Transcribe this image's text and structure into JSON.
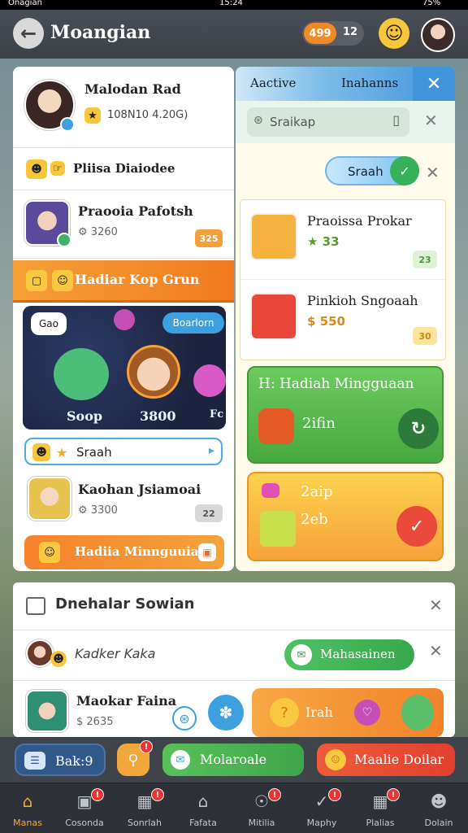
{
  "status_bar": {
    "carrier": "Onagian",
    "time": "15:24",
    "battery": "75%"
  },
  "header": {
    "title": "Moangian",
    "coin_value": "499",
    "count": "12"
  },
  "left_panel": {
    "profile": {
      "name": "Malodan Rad",
      "stats": "108N10 4.20G)"
    },
    "section_label": "Pliisa Diaiodee",
    "friend": {
      "name": "Praooia Pafotsh",
      "score": "3260",
      "badge": "325"
    },
    "banner_label": "Hadiar Kop Grun",
    "scene": {
      "bubble": "Gao",
      "pill": "Boarlorn",
      "label_left": "Soop",
      "label_right": "3800",
      "label_edge": "Fc"
    },
    "search_label": "Sraah",
    "friend2": {
      "name": "Kaohan Jsiamoai",
      "score": "3300",
      "badge": "22"
    },
    "button_label": "Hadiia Minnguuian"
  },
  "right_panel": {
    "tabs": [
      "Aactive",
      "Inahanns"
    ],
    "search_placeholder": "Sraikap",
    "search_pill": "Sraah",
    "items": [
      {
        "name": "Praoissa Prokar",
        "score": "33",
        "badge": "23"
      },
      {
        "name": "Pinkioh Sngoaah",
        "score": "550",
        "badge": "30"
      }
    ],
    "green_card": {
      "title": "H: Hadiah Mingguaan",
      "sub": "2ifin"
    },
    "yellow_card": {
      "line1": "2aip",
      "line2": "2eb"
    }
  },
  "bottom_panel": {
    "title": "Dnehalar Sowian",
    "row_name": "Kadker Kaka",
    "row_button": "Mahasainen",
    "row2_name": "Maokar Faina",
    "row2_score": "2635",
    "strip_label": "Irah"
  },
  "action_bar": {
    "left_btn": "Bak:9",
    "green_btn": "Molaroale",
    "red_btn": "Maalie Doilar"
  },
  "nav": [
    {
      "label": "Manas",
      "icon": "home-icon"
    },
    {
      "label": "Cosonda",
      "icon": "gamepad-icon"
    },
    {
      "label": "Sonrlah",
      "icon": "grid-icon"
    },
    {
      "label": "Fafata",
      "icon": "house-icon"
    },
    {
      "label": "Mitilia",
      "icon": "compass-icon"
    },
    {
      "label": "Maphy",
      "icon": "check-icon"
    },
    {
      "label": "Plalias",
      "icon": "store-icon"
    },
    {
      "label": "Dolain",
      "icon": "profile-icon"
    }
  ],
  "colors": {
    "accent": "#f4a73a",
    "green": "#38a84e",
    "blue": "#3f94da",
    "red": "#e94a3a"
  }
}
